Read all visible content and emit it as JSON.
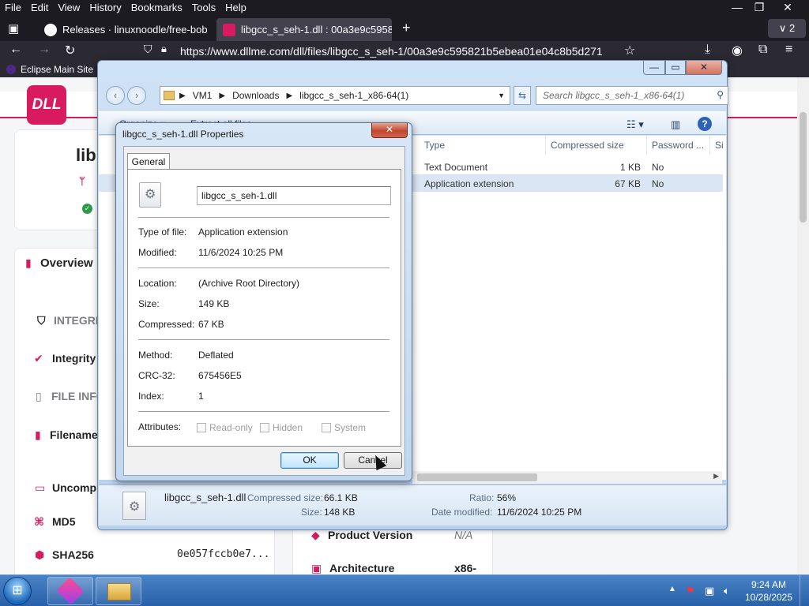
{
  "firefox": {
    "menus": [
      "File",
      "Edit",
      "View",
      "History",
      "Bookmarks",
      "Tools",
      "Help"
    ],
    "tabs": [
      {
        "title": "Releases · linuxnoodle/free-bob",
        "close": "✕"
      },
      {
        "title": "libgcc_s_seh-1.dll : 00a3e9c5958",
        "close": "✕"
      }
    ],
    "tab_count": "2",
    "url": "https://www.dllme.com/dll/files/libgcc_s_seh-1/00a3e9c595821b5ebea01e04c8b5d271",
    "bookmark": "Eclipse Main Site"
  },
  "webpage": {
    "logo": "DLL",
    "title_partial": "lib",
    "overview": "Overview",
    "integrity_header": "INTEGRI",
    "integrity": "Integrity",
    "file_info": "FILE INFO",
    "filename": "Filename",
    "uncompressed": "Uncomp",
    "md5": "MD5",
    "sha256": "SHA256",
    "sha256_value": "0e057fccb0e7...",
    "product_version": "Product Version",
    "product_version_value": "N/A",
    "architecture": "Architecture",
    "architecture_value": "x86-"
  },
  "explorer": {
    "breadcrumb": [
      "VM1",
      "Downloads",
      "libgcc_s_seh-1_x86-64(1)"
    ],
    "search_placeholder": "Search libgcc_s_seh-1_x86-64(1)",
    "toolbar": {
      "organize": "Organize ▾",
      "extract": "Extract all files"
    },
    "columns": [
      "Type",
      "Compressed size",
      "Password ...",
      "Si"
    ],
    "rows": [
      {
        "type": "Text Document",
        "size": "1 KB",
        "password": "No"
      },
      {
        "type": "Application extension",
        "size": "67 KB",
        "password": "No"
      }
    ],
    "details": {
      "name": "libgcc_s_seh-1.dll",
      "compressed_label": "Compressed size:",
      "compressed_value": "66.1 KB",
      "size_label": "Size:",
      "size_value": "148 KB",
      "ratio_label": "Ratio:",
      "ratio_value": "56%",
      "date_label": "Date modified:",
      "date_value": "11/6/2024 10:25 PM"
    }
  },
  "properties": {
    "title": "libgcc_s_seh-1.dll Properties",
    "tab": "General",
    "filename": "libgcc_s_seh-1.dll",
    "type_label": "Type of file:",
    "type_value": "Application extension",
    "modified_label": "Modified:",
    "modified_value": "11/6/2024 10:25 PM",
    "location_label": "Location:",
    "location_value": "(Archive Root Directory)",
    "size_label": "Size:",
    "size_value": "149 KB",
    "compressed_label": "Compressed:",
    "compressed_value": "67 KB",
    "method_label": "Method:",
    "method_value": "Deflated",
    "crc_label": "CRC-32:",
    "crc_value": "675456E5",
    "index_label": "Index:",
    "index_value": "1",
    "attributes_label": "Attributes:",
    "attr_readonly": "Read-only",
    "attr_hidden": "Hidden",
    "attr_system": "System",
    "ok": "OK",
    "cancel": "Cancel",
    "close": "✕"
  },
  "taskbar": {
    "time": "9:24 AM",
    "date": "10/28/2025"
  }
}
